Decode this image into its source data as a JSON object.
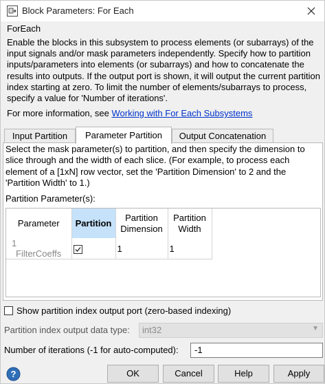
{
  "window": {
    "title": "Block Parameters: For Each",
    "icons": {
      "app": "block-parameters-icon",
      "close": "close-icon"
    }
  },
  "block_name": "ForEach",
  "description": "Enable the blocks in this subsystem to process elements (or subarrays) of the input signals and/or mask parameters independently. Specify how to partition inputs/parameters into elements (or subarrays) and how to concatenate the results into outputs. If the output port is shown, it will output the current partition index starting at zero.  To limit the number of elements/subarrays to process, specify a value for 'Number of iterations'.",
  "more_info": {
    "prefix": "For more information, see",
    "link": "Working with For Each Subsystems"
  },
  "tabs": [
    {
      "label": "Input Partition",
      "active": false
    },
    {
      "label": "Parameter Partition",
      "active": true
    },
    {
      "label": "Output Concatenation",
      "active": false
    }
  ],
  "parameter_partition": {
    "description": "Select the mask parameter(s) to partition, and then specify the dimension to slice through and the width of each slice. (For example, to process each element of a [1xN] row vector, set the 'Partition Dimension' to 2 and the 'Partition Width' to 1.)",
    "table_label": "Partition Parameter(s):",
    "columns": {
      "parameter": "Parameter",
      "partition": "Partition",
      "dimension": [
        "Partition",
        "Dimension"
      ],
      "width": [
        "Partition",
        "Width"
      ]
    },
    "rows": [
      {
        "index": "1",
        "parameter": "FilterCoeffs",
        "partition": true,
        "dimension": "1",
        "width": "1"
      }
    ]
  },
  "show_port": {
    "label": "Show partition index output port (zero-based indexing)",
    "checked": false
  },
  "data_type": {
    "label": "Partition index output data type:",
    "value": "int32",
    "enabled": false
  },
  "iterations": {
    "label": "Number of iterations (-1 for auto-computed):",
    "value": "-1"
  },
  "buttons": {
    "ok": "OK",
    "cancel": "Cancel",
    "help": "Help",
    "apply": "Apply"
  },
  "colors": {
    "accent": "#0033cc",
    "header_selected": "#c5e2fa",
    "help_icon": "#2f6fb8"
  }
}
